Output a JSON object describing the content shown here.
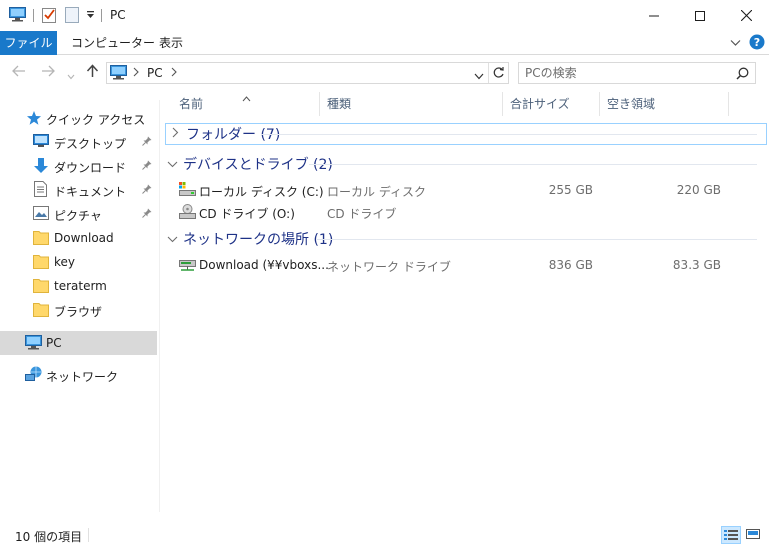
{
  "titlebar": {
    "title": "PC",
    "qat_icons": [
      "computer-icon",
      "properties-check-icon",
      "new-folder-icon",
      "qat-dropdown-icon"
    ],
    "window_buttons": [
      "minimize-icon",
      "maximize-icon",
      "close-icon"
    ]
  },
  "ribbon": {
    "tabs": [
      "ファイル",
      "コンピューター",
      "表示"
    ],
    "active_tab": "ファイル",
    "accent": "#1979ca"
  },
  "address": {
    "path": [
      "PC"
    ],
    "search_placeholder": "PCの検索"
  },
  "sidebar": {
    "items": [
      {
        "label": "クイック アクセス",
        "icon": "star-icon",
        "pinned": false
      },
      {
        "label": "デスクトップ",
        "icon": "desktop-icon",
        "pinned": true
      },
      {
        "label": "ダウンロード",
        "icon": "download-arrow-icon",
        "pinned": true
      },
      {
        "label": "ドキュメント",
        "icon": "document-icon",
        "pinned": true
      },
      {
        "label": "ピクチャ",
        "icon": "pictures-icon",
        "pinned": true
      },
      {
        "label": "Download",
        "icon": "folder-icon",
        "pinned": false
      },
      {
        "label": "key",
        "icon": "folder-icon",
        "pinned": false
      },
      {
        "label": "teraterm",
        "icon": "folder-icon",
        "pinned": false
      },
      {
        "label": "ブラウザ",
        "icon": "folder-icon",
        "pinned": false
      },
      {
        "label": "PC",
        "icon": "computer-icon",
        "pinned": false,
        "selected": true
      },
      {
        "label": "ネットワーク",
        "icon": "network-icon",
        "pinned": false
      }
    ]
  },
  "columns": [
    "名前",
    "種類",
    "合計サイズ",
    "空き領域"
  ],
  "groups": [
    {
      "label": "フォルダー (7)",
      "expanded": false,
      "items": []
    },
    {
      "label": "デバイスとドライブ (2)",
      "expanded": true,
      "items": [
        {
          "name": "ローカル ディスク (C:)",
          "type": "ローカル ディスク",
          "total": "255 GB",
          "free": "220 GB",
          "icon": "hard-drive-icon"
        },
        {
          "name": "CD ドライブ (O:)",
          "type": "CD ドライブ",
          "total": "",
          "free": "",
          "icon": "cd-drive-icon"
        }
      ]
    },
    {
      "label": "ネットワークの場所 (1)",
      "expanded": true,
      "items": [
        {
          "name": "Download (¥¥vboxs...",
          "type": "ネットワーク ドライブ",
          "total": "836 GB",
          "free": "83.3 GB",
          "icon": "network-drive-icon"
        }
      ]
    }
  ],
  "status": {
    "item_count": "10 個の項目"
  }
}
